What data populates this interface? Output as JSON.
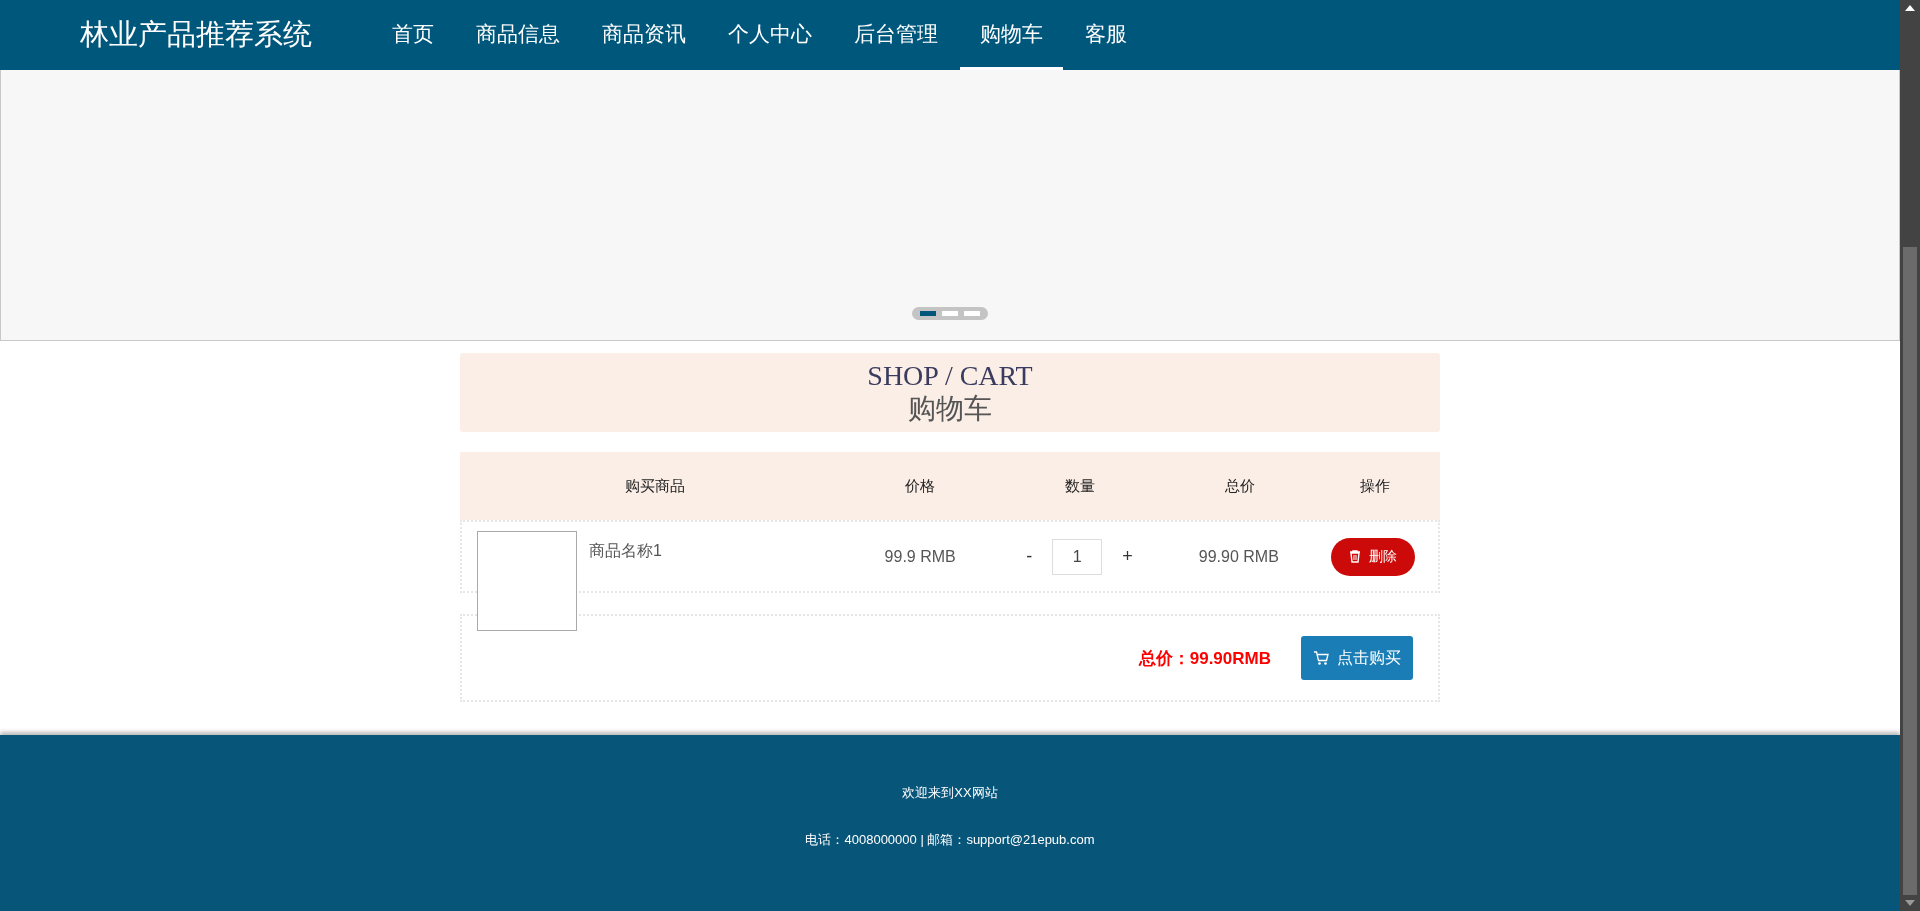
{
  "header": {
    "brand": "林业产品推荐系统",
    "nav": [
      {
        "label": "首页",
        "selected": false
      },
      {
        "label": "商品信息",
        "selected": false
      },
      {
        "label": "商品资讯",
        "selected": false
      },
      {
        "label": "个人中心",
        "selected": false
      },
      {
        "label": "后台管理",
        "selected": false
      },
      {
        "label": "购物车",
        "selected": true
      },
      {
        "label": "客服",
        "selected": false
      }
    ]
  },
  "carousel": {
    "dots": [
      {
        "selected": true
      },
      {
        "selected": false
      },
      {
        "selected": false
      }
    ]
  },
  "title": {
    "english": "SHOP / CART",
    "chinese": "购物车"
  },
  "table": {
    "columns": [
      "购买商品",
      "价格",
      "数量",
      "总价",
      "操作"
    ],
    "rows": [
      {
        "name": "商品名称1",
        "price": "99.9 RMB",
        "minus": "-",
        "quantity": "1",
        "plus": "+",
        "total": "99.90 RMB",
        "action": "删除"
      }
    ]
  },
  "summary": {
    "total": "总价：99.90RMB",
    "buy": "点击购买"
  },
  "footer": {
    "welcome": "欢迎来到XX网站",
    "contact": "电话：4008000000 | 邮箱：support@21epub.com"
  }
}
